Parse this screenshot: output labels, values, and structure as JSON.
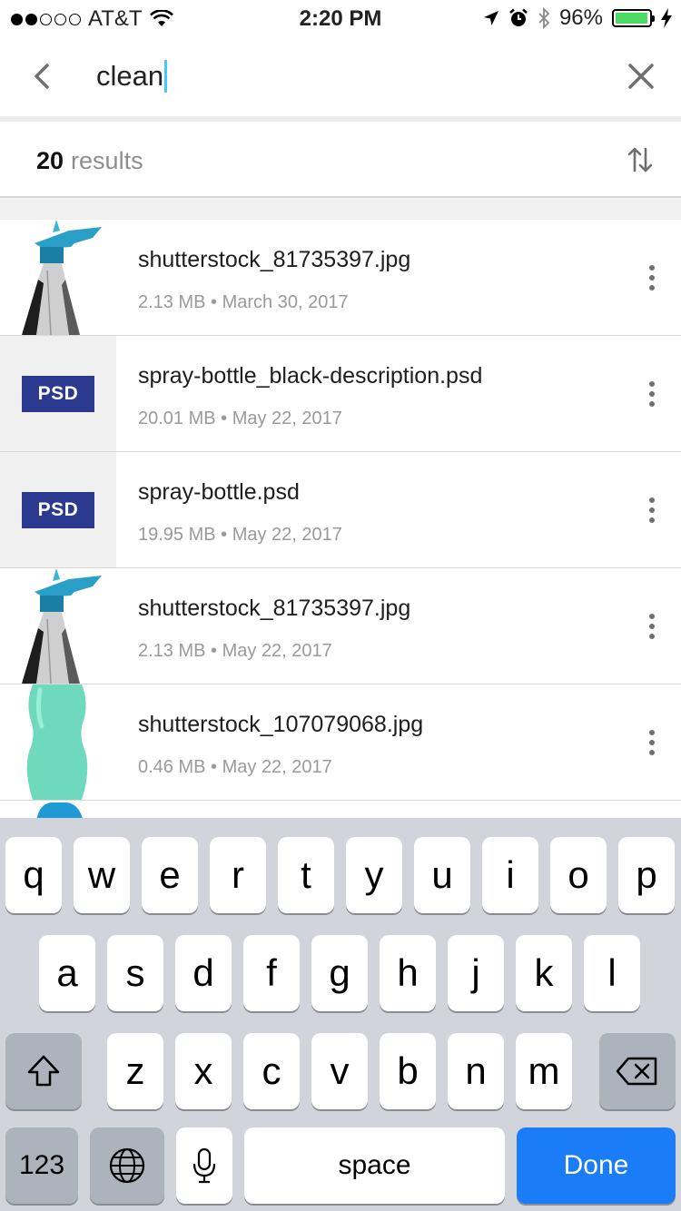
{
  "status_bar": {
    "carrier": "AT&T",
    "time": "2:20 PM",
    "battery": "96%",
    "battery_level": 0.96
  },
  "search": {
    "query": "clean"
  },
  "results": {
    "count": "20",
    "label": "results"
  },
  "files": [
    {
      "name": "shutterstock_81735397.jpg",
      "meta": "2.13 MB • March 30, 2017",
      "thumb": "spray-bottle"
    },
    {
      "name": "spray-bottle_black-description.psd",
      "meta": "20.01 MB • May 22, 2017",
      "thumb": "psd",
      "badge": "PSD"
    },
    {
      "name": "spray-bottle.psd",
      "meta": "19.95 MB • May 22, 2017",
      "thumb": "psd",
      "badge": "PSD"
    },
    {
      "name": "shutterstock_81735397.jpg",
      "meta": "2.13 MB • May 22, 2017",
      "thumb": "spray-bottle"
    },
    {
      "name": "shutterstock_107079068.jpg",
      "meta": "0.46 MB • May 22, 2017",
      "thumb": "green-bottle"
    }
  ],
  "keyboard": {
    "row1": [
      "q",
      "w",
      "e",
      "r",
      "t",
      "y",
      "u",
      "i",
      "o",
      "p"
    ],
    "row2": [
      "a",
      "s",
      "d",
      "f",
      "g",
      "h",
      "j",
      "k",
      "l"
    ],
    "row3": [
      "z",
      "x",
      "c",
      "v",
      "b",
      "n",
      "m"
    ],
    "numbers_key": "123",
    "space_key": "space",
    "done_key": "Done"
  },
  "colors": {
    "accent": "#44c8f5",
    "psd_badge": "#2b3a8e",
    "done_key": "#1a7cf7",
    "battery": "#4cd964"
  }
}
